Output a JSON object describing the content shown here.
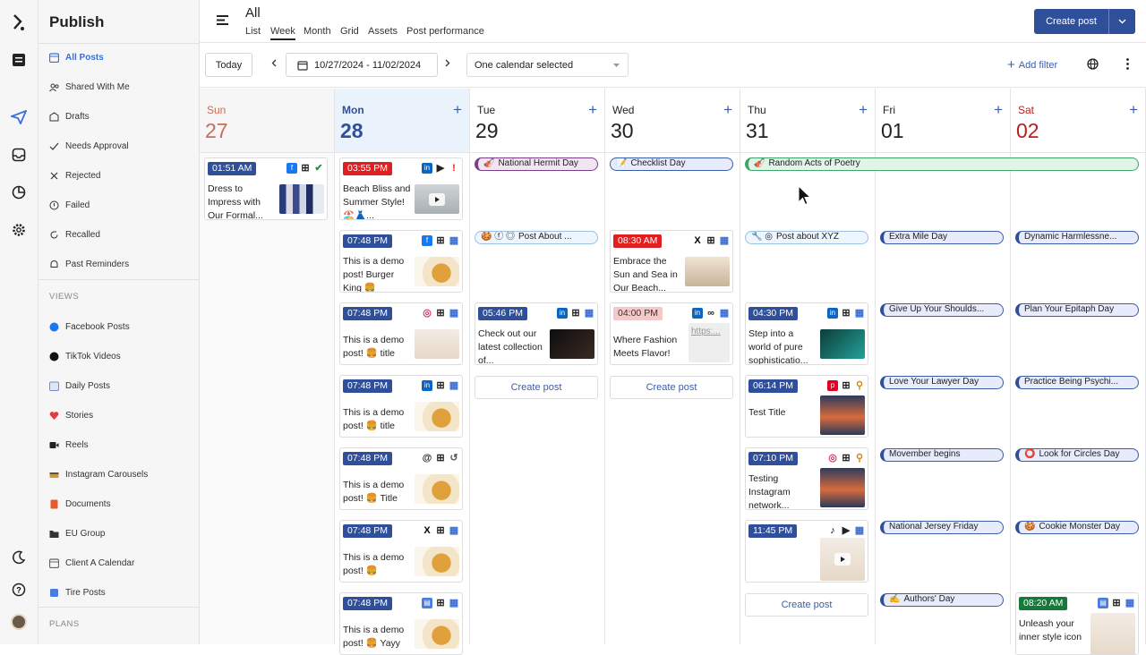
{
  "app": {
    "title": "Publish"
  },
  "sidebar": {
    "items": [
      {
        "label": "All Posts",
        "icon": "calendar-icon"
      },
      {
        "label": "Shared With Me",
        "icon": "share-icon"
      },
      {
        "label": "Drafts",
        "icon": "draft-icon"
      },
      {
        "label": "Needs Approval",
        "icon": "approval-icon"
      },
      {
        "label": "Rejected",
        "icon": "x-icon"
      },
      {
        "label": "Failed",
        "icon": "failed-icon"
      },
      {
        "label": "Recalled",
        "icon": "recall-icon"
      },
      {
        "label": "Past Reminders",
        "icon": "bell-icon"
      }
    ],
    "views_header": "VIEWS",
    "views": [
      {
        "label": "Facebook Posts",
        "icon": "facebook-icon"
      },
      {
        "label": "TikTok Videos",
        "icon": "tiktok-icon"
      },
      {
        "label": "Daily Posts",
        "icon": "daily-icon"
      },
      {
        "label": "Stories",
        "icon": "heart-icon"
      },
      {
        "label": "Reels",
        "icon": "reels-icon"
      },
      {
        "label": "Instagram Carousels",
        "icon": "carousel-icon"
      },
      {
        "label": "Documents",
        "icon": "document-icon"
      },
      {
        "label": "EU Group",
        "icon": "folder-icon"
      },
      {
        "label": "Client A Calendar",
        "icon": "calendar-icon"
      },
      {
        "label": "Tire Posts",
        "icon": "tire-icon"
      }
    ],
    "plans_header": "PLANS"
  },
  "header": {
    "title": "All",
    "tabs": [
      "List",
      "Week",
      "Month",
      "Grid",
      "Assets",
      "Post performance"
    ],
    "create_label": "Create post"
  },
  "toolbar": {
    "today": "Today",
    "date_range": "10/27/2024 - 11/02/2024",
    "calendar_select": "One calendar selected",
    "add_filter": "Add filter"
  },
  "days": [
    {
      "name": "Sun",
      "date": "27"
    },
    {
      "name": "Mon",
      "date": "28"
    },
    {
      "name": "Tue",
      "date": "29"
    },
    {
      "name": "Wed",
      "date": "30"
    },
    {
      "name": "Thu",
      "date": "31"
    },
    {
      "name": "Fri",
      "date": "01"
    },
    {
      "name": "Sat",
      "date": "02"
    }
  ],
  "events": {
    "hermit": "National Hermit Day",
    "checklist": "Checklist Day",
    "poetry": "Random Acts of Poetry",
    "post_about": "Post About ...",
    "post_xyz": "Post about XYZ",
    "extra_mile": "Extra Mile Day",
    "give_up": "Give Up Your Shoulds...",
    "lawyer": "Love Your Lawyer Day",
    "movember": "Movember begins",
    "jersey": "National Jersey Friday",
    "authors": "Authors' Day",
    "dynamic": "Dynamic Harmlessne...",
    "epitaph": "Plan Your Epitaph Day",
    "psychic": "Practice Being Psychi...",
    "circles": "Look for Circles Day",
    "cookie": "Cookie Monster Day"
  },
  "posts": {
    "sun1": {
      "time": "01:51 AM",
      "text": "Dress to Impress with Our Formal..."
    },
    "mon1": {
      "time": "03:55 PM",
      "text": "Beach Bliss and Summer Style! 🏖️👗..."
    },
    "mon2": {
      "time": "07:48 PM",
      "text": "This is a demo post! Burger King 🍔"
    },
    "mon3": {
      "time": "07:48 PM",
      "text": "This is a demo post! 🍔 title"
    },
    "mon4": {
      "time": "07:48 PM",
      "text": "This is a demo post! 🍔 title"
    },
    "mon5": {
      "time": "07:48 PM",
      "text": "This is a demo post! 🍔 Title"
    },
    "mon6": {
      "time": "07:48 PM",
      "text": "This is a demo post! 🍔"
    },
    "mon7": {
      "time": "07:48 PM",
      "text": "This is a demo post! 🍔 Yayy"
    },
    "tue1": {
      "time": "05:46 PM",
      "text": "Check out our latest collection of..."
    },
    "wed1": {
      "time": "08:30 AM",
      "text": "Embrace the Sun and Sea in Our Beach..."
    },
    "wed2": {
      "time": "04:00 PM",
      "text": "Where Fashion Meets Flavor!",
      "link": "https:..."
    },
    "thu1": {
      "time": "04:30 PM",
      "text": "Step into a world of pure sophisticatio..."
    },
    "thu2": {
      "time": "06:14 PM",
      "text": "Test Title"
    },
    "thu3": {
      "time": "07:10 PM",
      "text": "Testing Instagram network..."
    },
    "thu4": {
      "time": "11:45 PM",
      "text": ""
    },
    "sat1": {
      "time": "08:20 AM",
      "text": "Unleash your inner style icon"
    }
  },
  "create_post": "Create post"
}
